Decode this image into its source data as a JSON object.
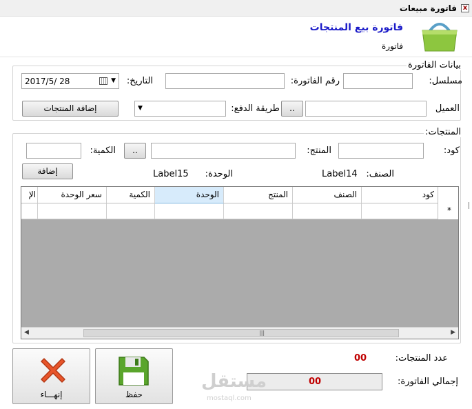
{
  "window": {
    "title": "فاتورة مبيعات",
    "close_label": "x"
  },
  "header": {
    "title": "فاتورة بيع المنتجات",
    "subtitle": "فاتورة",
    "icon": "basket-icon"
  },
  "invoice_group": {
    "title": "بيانات الفاتورة",
    "serial_label": "مسلسل:",
    "serial_value": "",
    "invoice_no_label": "رقم الفاتورة:",
    "invoice_no_value": "",
    "date_label": "التاريخ:",
    "date_value": "2017/5/  28",
    "customer_label": "العميل",
    "customer_value": "",
    "customer_browse_label": "..",
    "payment_label": "طريقة الدفع:",
    "payment_selected": "",
    "add_products_label": "إضافة المنتجات"
  },
  "products_group": {
    "title": "المنتجات:",
    "code_label": "كود:",
    "code_value": "",
    "product_label": "المنتج:",
    "product_value": "",
    "browse_label": "..",
    "qty_label": "الكمية:",
    "qty_value": "",
    "add_label": "إضافة",
    "category_label": "الصنف:",
    "category_value": "Label14",
    "unit_label": "الوحدة:",
    "unit_value": "Label15"
  },
  "grid": {
    "columns": [
      "كود",
      "الصنف",
      "المنتج",
      "الوحدة",
      "الكمية",
      "سعر الوحدة",
      "الإ"
    ],
    "new_row_marker": "*"
  },
  "summary": {
    "count_label": "عدد المنتجات:",
    "count_value": "00",
    "total_label": "إجمالي الفاتورة:",
    "total_value": "00"
  },
  "buttons": {
    "save_label": "حفظ",
    "exit_label": "إنهـــاء"
  },
  "watermark": {
    "text": "مستقل",
    "sub": "mostaql.com"
  },
  "colors": {
    "title_blue": "#1a1ac8",
    "value_red": "#c00000",
    "grid_bg": "#ababab",
    "selected_header": "#d7ebfb"
  }
}
